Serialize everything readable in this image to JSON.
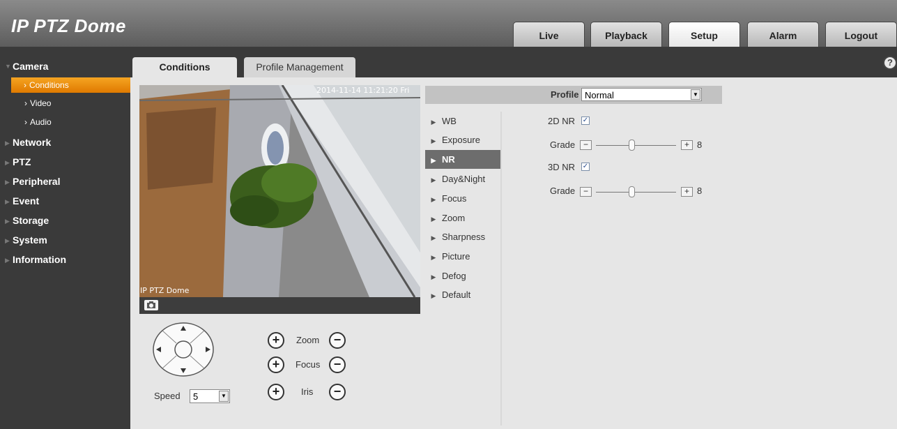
{
  "app": {
    "title": "IP PTZ Dome"
  },
  "nav": {
    "tabs": [
      "Live",
      "Playback",
      "Setup",
      "Alarm",
      "Logout"
    ],
    "active": "Setup"
  },
  "sidebar": {
    "camera": "Camera",
    "camera_children": [
      "Conditions",
      "Video",
      "Audio"
    ],
    "items": [
      "Network",
      "PTZ",
      "Peripheral",
      "Event",
      "Storage",
      "System",
      "Information"
    ]
  },
  "content_tabs": [
    "Conditions",
    "Profile Management"
  ],
  "video": {
    "timestamp": "2014-11-14 11:21:20 Fri",
    "channel_name": "IP PTZ Dome"
  },
  "profile": {
    "label": "Profile",
    "value": "Normal"
  },
  "menu": [
    "WB",
    "Exposure",
    "NR",
    "Day&Night",
    "Focus",
    "Zoom",
    "Sharpness",
    "Picture",
    "Defog",
    "Default"
  ],
  "menu_active": "NR",
  "nr": {
    "nr2d_label": "2D NR",
    "nr2d_checked": true,
    "grade_label": "Grade",
    "grade2d_value": "8",
    "nr3d_label": "3D NR",
    "nr3d_checked": true,
    "grade3d_value": "8",
    "grade_max": 100
  },
  "ptz": {
    "speed_label": "Speed",
    "speed_value": "5",
    "zoom_label": "Zoom",
    "focus_label": "Focus",
    "iris_label": "Iris"
  },
  "colors": {
    "accent": "#F08C00",
    "sidebar_bg": "#3A3A3A",
    "content_bg": "#E6E6E6"
  },
  "icons": {
    "help": "help-icon",
    "snapshot": "camera-icon"
  }
}
